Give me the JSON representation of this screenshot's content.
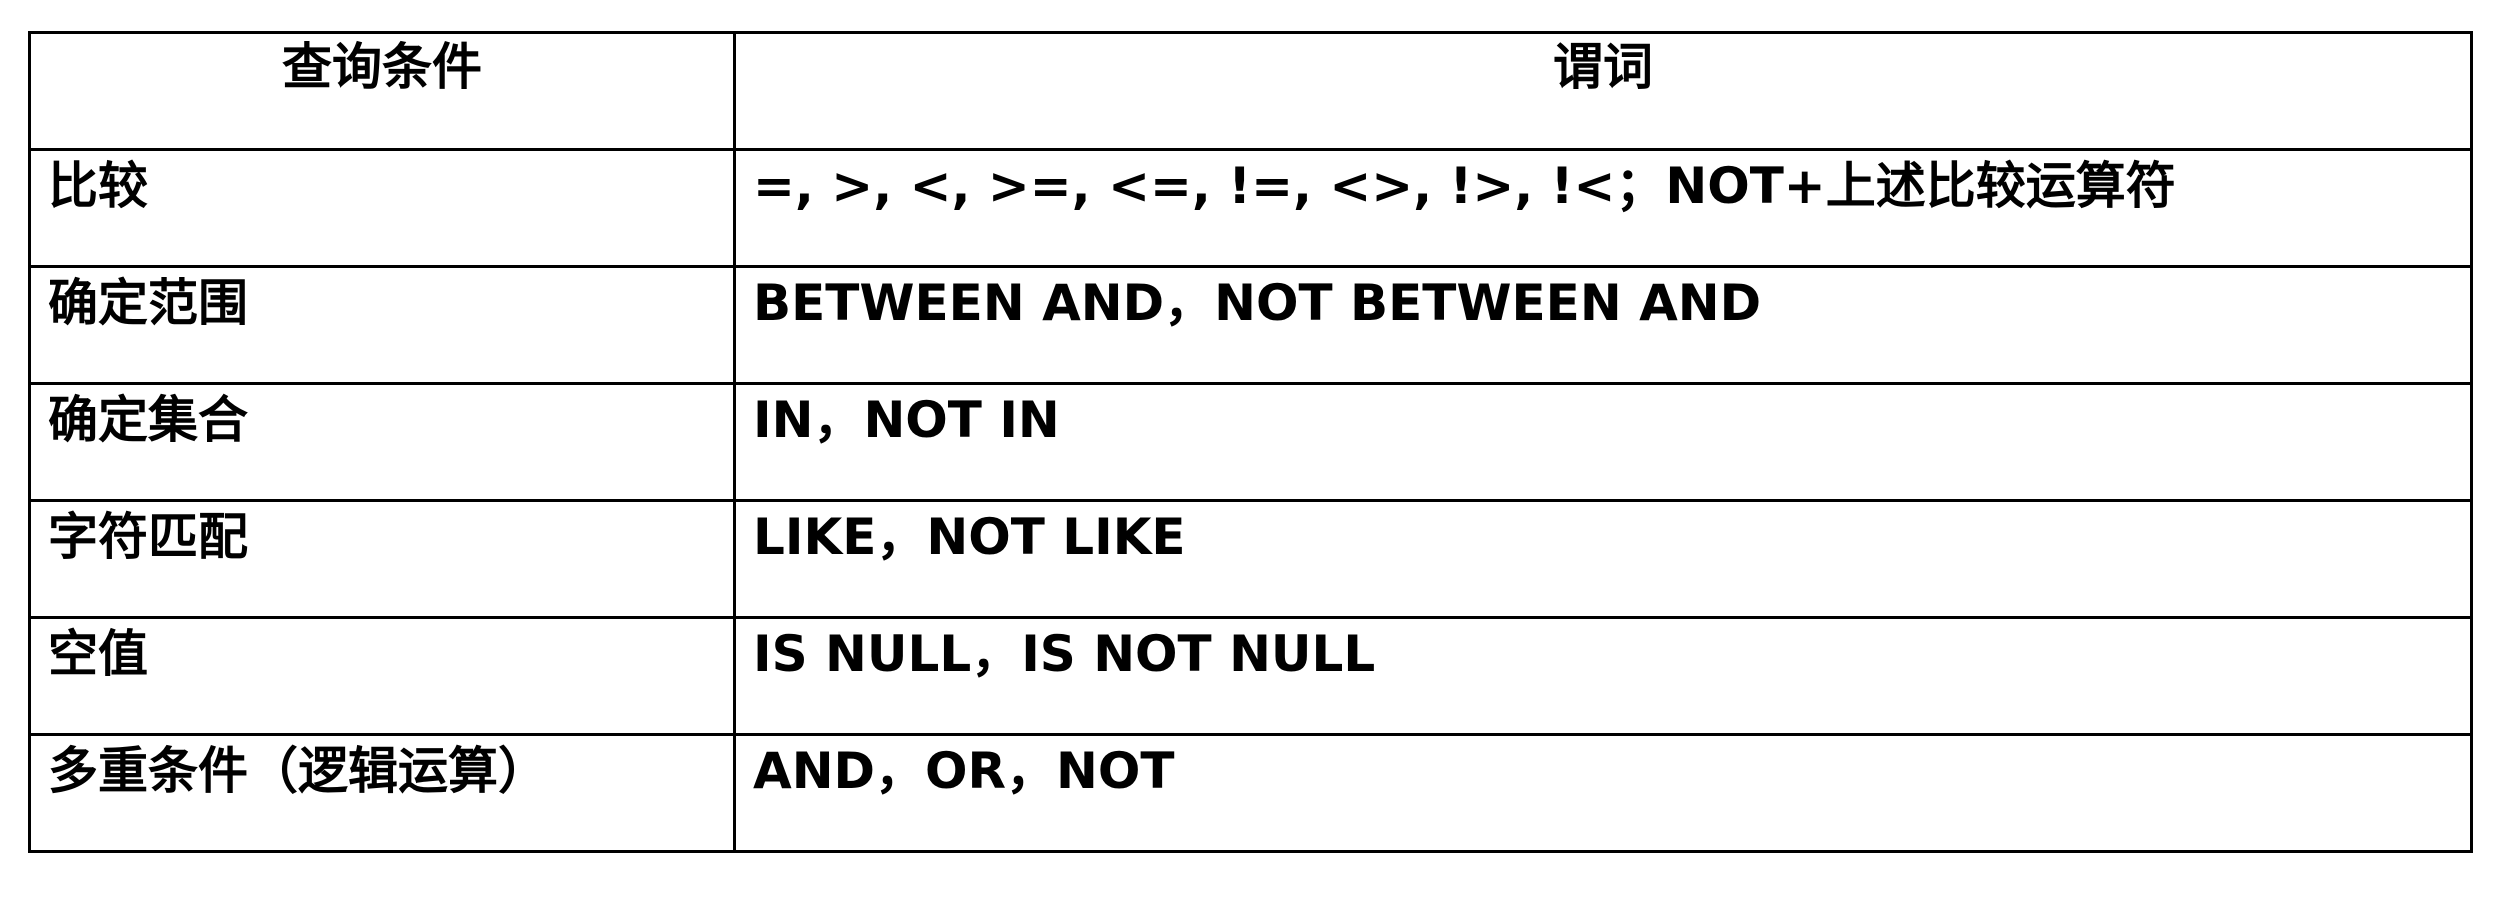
{
  "table": {
    "headers": [
      "查询条件",
      "谓词"
    ],
    "rows": [
      {
        "condition": "比较",
        "predicate": "=, >, <, >=, <=, !=, <>, !>, !<；NOT+上述比较运算符"
      },
      {
        "condition": "确定范围",
        "predicate": "BETWEEN AND，NOT BETWEEN AND"
      },
      {
        "condition": "确定集合",
        "predicate": "IN，NOT IN"
      },
      {
        "condition": "字符匹配",
        "predicate": "LIKE，NOT LIKE"
      },
      {
        "condition": "空值",
        "predicate": "IS NULL，IS NOT NULL"
      },
      {
        "condition": "多重条件（逻辑运算）",
        "predicate": "AND，OR，NOT"
      }
    ]
  }
}
